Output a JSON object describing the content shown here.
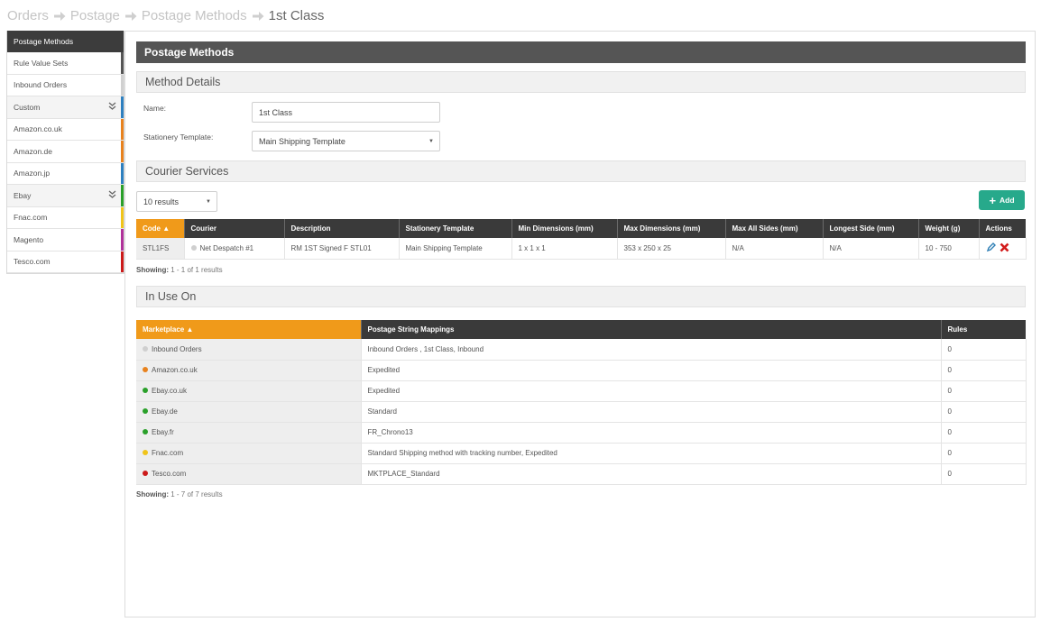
{
  "breadcrumb": [
    {
      "label": "Orders",
      "current": false
    },
    {
      "label": "Postage",
      "current": false
    },
    {
      "label": "Postage Methods",
      "current": false
    },
    {
      "label": "1st Class",
      "current": true
    }
  ],
  "sidebar": {
    "items": [
      {
        "label": "Postage Methods",
        "active": true,
        "group": false,
        "color": ""
      },
      {
        "label": "Rule Value Sets",
        "active": false,
        "group": false,
        "color": "#555555"
      },
      {
        "label": "Inbound Orders",
        "active": false,
        "group": false,
        "color": "#d0d0d0"
      },
      {
        "label": "Custom",
        "active": false,
        "group": true,
        "color": "#2e80c0"
      },
      {
        "label": "Amazon.co.uk",
        "active": false,
        "group": false,
        "color": "#e8821e"
      },
      {
        "label": "Amazon.de",
        "active": false,
        "group": false,
        "color": "#e8821e"
      },
      {
        "label": "Amazon.jp",
        "active": false,
        "group": false,
        "color": "#2e80c0"
      },
      {
        "label": "Ebay",
        "active": false,
        "group": true,
        "color": "#2aa02a"
      },
      {
        "label": "Fnac.com",
        "active": false,
        "group": false,
        "color": "#f0c419"
      },
      {
        "label": "Magento",
        "active": false,
        "group": false,
        "color": "#b0329a"
      },
      {
        "label": "Tesco.com",
        "active": false,
        "group": false,
        "color": "#cc1a1a"
      }
    ]
  },
  "panel": {
    "title": "Postage Methods",
    "method_details": {
      "heading": "Method Details",
      "name_label": "Name:",
      "name_value": "1st Class",
      "stationery_label": "Stationery Template:",
      "stationery_value": "Main Shipping Template"
    },
    "courier_services": {
      "heading": "Courier Services",
      "page_size": "10 results",
      "add_label": "Add",
      "columns": [
        "Code ▲",
        "Courier",
        "Description",
        "Stationery Template",
        "Min Dimensions (mm)",
        "Max Dimensions (mm)",
        "Max All Sides (mm)",
        "Longest Side (mm)",
        "Weight (g)",
        "Actions"
      ],
      "rows": [
        {
          "code": "STL1FS",
          "courier": "Net Despatch #1",
          "courier_color": "#cfcfcf",
          "description": "RM 1ST Signed F STL01",
          "stationery": "Main Shipping Template",
          "min_dim": "1 x 1 x 1",
          "max_dim": "353 x 250 x 25",
          "max_all_sides": "N/A",
          "longest_side": "N/A",
          "weight": "10 - 750"
        }
      ],
      "showing_label": "Showing:",
      "showing_text": "1 - 1 of 1 results"
    },
    "in_use_on": {
      "heading": "In Use On",
      "columns": [
        "Marketplace ▲",
        "Postage String Mappings",
        "Rules"
      ],
      "rows": [
        {
          "marketplace": "Inbound Orders",
          "color": "#cfcfcf",
          "mappings": "Inbound Orders , 1st Class, Inbound",
          "rules": "0"
        },
        {
          "marketplace": "Amazon.co.uk",
          "color": "#e8821e",
          "mappings": "Expedited",
          "rules": "0"
        },
        {
          "marketplace": "Ebay.co.uk",
          "color": "#2aa02a",
          "mappings": "Expedited",
          "rules": "0"
        },
        {
          "marketplace": "Ebay.de",
          "color": "#2aa02a",
          "mappings": "Standard",
          "rules": "0"
        },
        {
          "marketplace": "Ebay.fr",
          "color": "#2aa02a",
          "mappings": "FR_Chrono13",
          "rules": "0"
        },
        {
          "marketplace": "Fnac.com",
          "color": "#f0c419",
          "mappings": "Standard Shipping method with tracking number, Expedited",
          "rules": "0"
        },
        {
          "marketplace": "Tesco.com",
          "color": "#cc1a1a",
          "mappings": "MKTPLACE_Standard",
          "rules": "0"
        }
      ],
      "showing_label": "Showing:",
      "showing_text": "1 - 7 of 7 results"
    }
  },
  "colors": {
    "accent_orange": "#f09a1a",
    "add_green": "#27a98b",
    "header_dark": "#3a3a3a"
  }
}
